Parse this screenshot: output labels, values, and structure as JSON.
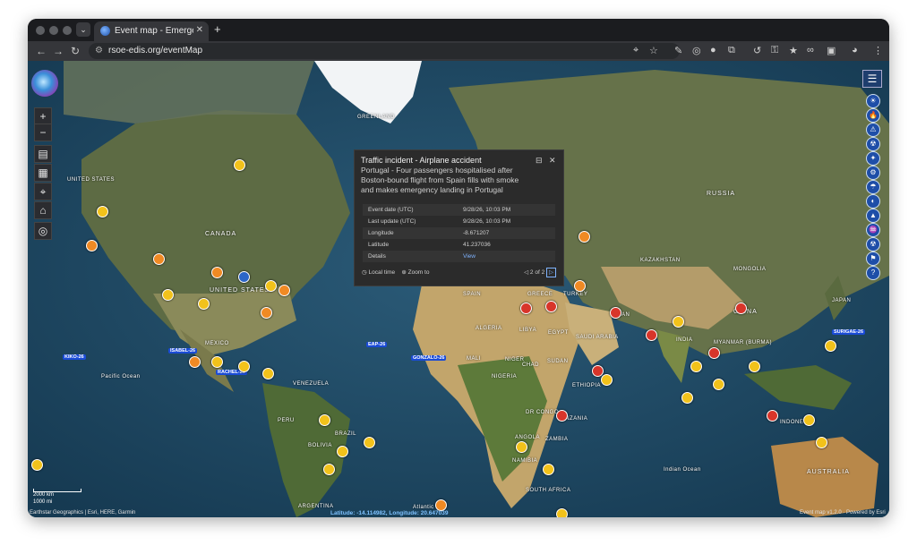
{
  "browser": {
    "tab_title": "Event map - Emergency and",
    "tab_close": "✕",
    "new_tab": "+",
    "url": "rsoe-edis.org/eventMap",
    "nav": {
      "back": "←",
      "forward": "→",
      "reload": "↻"
    }
  },
  "map_controls": {
    "zoom_in": "+",
    "zoom_out": "−",
    "tools": [
      "▤",
      "▦",
      "⌖",
      "⌂",
      "◎"
    ]
  },
  "categories": [
    "☀",
    "🔥",
    "⚠",
    "☢",
    "✦",
    "⚙",
    "☂",
    "◐",
    "▲",
    "♒",
    "☢",
    "⚑",
    "?"
  ],
  "popup": {
    "title": "Traffic incident - Airplane accident",
    "description": "Portugal - Four passengers hospitalised after Boston-bound flight from Spain fills with smoke and makes emergency landing in Portugal",
    "dock_icon": "⊟",
    "close_icon": "✕",
    "rows": [
      {
        "label": "Event date (UTC)",
        "value": "9/28/26, 10:03 PM"
      },
      {
        "label": "Last update (UTC)",
        "value": "9/28/26, 10:03 PM"
      },
      {
        "label": "Longitude",
        "value": "-8.671207"
      },
      {
        "label": "Latitude",
        "value": "41.237036"
      },
      {
        "label": "Details",
        "value": "View"
      }
    ],
    "local_time": "Local time",
    "zoom_to": "Zoom to",
    "pager": "2 of 2"
  },
  "places": [
    {
      "name": "GREENLAND"
    },
    {
      "name": "CANADA"
    },
    {
      "name": "UNITED STATES"
    },
    {
      "name": "UNITED STATES"
    },
    {
      "name": "MEXICO"
    },
    {
      "name": "RUSSIA"
    },
    {
      "name": "KAZAKHSTAN"
    },
    {
      "name": "MONGOLIA"
    },
    {
      "name": "CHINA"
    },
    {
      "name": "INDIA"
    },
    {
      "name": "IRAN"
    },
    {
      "name": "TURKEY"
    },
    {
      "name": "SPAIN"
    },
    {
      "name": "GREECE"
    },
    {
      "name": "ALGERIA"
    },
    {
      "name": "LIBYA"
    },
    {
      "name": "EGYPT"
    },
    {
      "name": "MALI"
    },
    {
      "name": "NIGER"
    },
    {
      "name": "CHAD"
    },
    {
      "name": "SUDAN"
    },
    {
      "name": "NIGERIA"
    },
    {
      "name": "ETHIOPIA"
    },
    {
      "name": "DR CONGO"
    },
    {
      "name": "TANZANIA"
    },
    {
      "name": "ANGOLA"
    },
    {
      "name": "ZAMBIA"
    },
    {
      "name": "NAMIBIA"
    },
    {
      "name": "SOUTH AFRICA"
    },
    {
      "name": "SAUDI ARABIA"
    },
    {
      "name": "BRAZIL"
    },
    {
      "name": "PERU"
    },
    {
      "name": "BOLIVIA"
    },
    {
      "name": "VENEZUELA"
    },
    {
      "name": "ARGENTINA"
    },
    {
      "name": "AUSTRALIA"
    },
    {
      "name": "INDONESIA"
    },
    {
      "name": "JAPAN"
    },
    {
      "name": "MYANMAR (BURMA)"
    },
    {
      "name": "Pacific Ocean"
    },
    {
      "name": "Indian Ocean"
    },
    {
      "name": "Atlantic"
    }
  ],
  "storms": [
    "GONZALO-26",
    "EAP-26",
    "KIKO-26",
    "ISABEL-26",
    "RACHEL-26",
    "SURIGAE-26"
  ],
  "footer": {
    "attribution": "Earthstar Geographics | Esri, HERE, Garmin",
    "coordinates": "Latitude: -14.114982, Longitude: 20.647039",
    "version": "Event map v1.2.0 · Powered by Esri"
  },
  "scale": {
    "km": "2000 km",
    "mi": "1000 mi"
  },
  "colors": {
    "ocean": "#1d4560",
    "land": "#5a6a3f",
    "desert": "#c9b07a",
    "ice": "#f2f4f6",
    "accent": "#1e4ea8"
  }
}
